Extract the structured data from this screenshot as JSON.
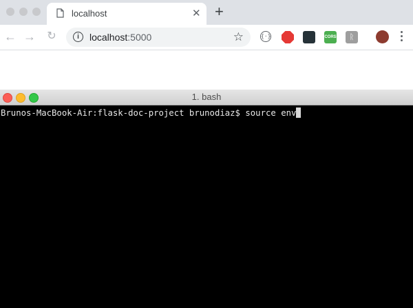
{
  "browser": {
    "tab": {
      "title": "localhost",
      "close": "✕"
    },
    "new_tab": "+",
    "address": {
      "host": "localhost",
      "port": ":5000"
    },
    "extensions": [
      {
        "name": "code-icon",
        "color": "#ffffff"
      },
      {
        "name": "adblock-icon",
        "color": "#e53935"
      },
      {
        "name": "dark-extension-icon",
        "color": "#263238"
      },
      {
        "name": "cors-icon",
        "color": "#4caf50",
        "label": "CORS"
      },
      {
        "name": "wappalyzer-icon",
        "color": "#9e9e9e"
      },
      {
        "name": "profile-avatar",
        "color": "#8d3b2f"
      }
    ]
  },
  "terminal": {
    "title": "1. bash",
    "prompt": "Brunos-MacBook-Air:flask-doc-project brunodiaz$ ",
    "command": "source env"
  }
}
